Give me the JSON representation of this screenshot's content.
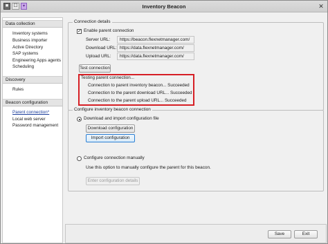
{
  "window": {
    "title": "Inventory Beacon"
  },
  "titlebar": {
    "app_icon": "app-icon",
    "qat_glyph": "☐",
    "extra_glyph": "▾",
    "close_glyph": "✕"
  },
  "sidebar": {
    "sections": [
      {
        "heading": "Data collection",
        "items": [
          "Inventory systems",
          "Business importer",
          "Active Directory",
          "SAP systems",
          "Engineering Apps agents",
          "Scheduling"
        ]
      },
      {
        "heading": "Discovery",
        "items": [
          "Rules"
        ]
      },
      {
        "heading": "Beacon configuration",
        "items": [
          "Parent connection*",
          "Local web server",
          "Password management"
        ]
      }
    ],
    "selected_item": "Parent connection*"
  },
  "connection_details": {
    "group_label": "Connection details",
    "enable_label": "Enable parent connection",
    "enable_checked": true,
    "server_url_label": "Server URL:",
    "server_url_value": "https://beacon.flexnetmanager.com/",
    "download_url_label": "Download URL:",
    "download_url_value": "https://data.flexnetmanager.com/",
    "upload_url_label": "Upload URL:",
    "upload_url_value": "https://data.flexnetmanager.com/",
    "test_button": "Test connection",
    "test_results": {
      "heading": "Testing parent connection...",
      "lines": [
        "Connection to parent inventory beacon... Succeeded",
        "Connection to the parent download URL... Succeeded",
        "Connection to the parent upload URL... Succeeded"
      ],
      "highlight_color": "#d61e24"
    }
  },
  "configure_beacon": {
    "group_label": "Configure inventory beacon connection",
    "option_download_label": "Download and import configuration file",
    "option_download_selected": true,
    "download_button": "Download configuration",
    "import_button": "Import configuration",
    "option_manual_label": "Configure connection manually",
    "option_manual_selected": false,
    "manual_hint": "Use this option to manually configure the parent for this beacon.",
    "enter_details_button": "Enter configuration details"
  },
  "footer": {
    "save_button": "Save",
    "exit_button": "Exit"
  }
}
